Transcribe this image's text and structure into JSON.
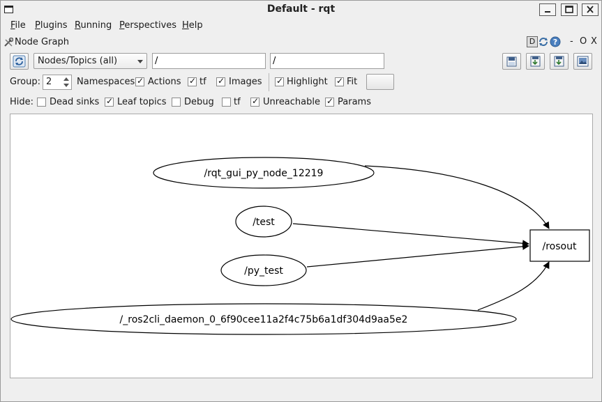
{
  "window": {
    "title": "Default - rqt",
    "minimize_glyph": "_",
    "maximize_glyph": "□",
    "close_glyph": "✕"
  },
  "menu": {
    "items": [
      {
        "label": "File",
        "mnemonic": "F",
        "rest": "ile"
      },
      {
        "label": "Plugins",
        "mnemonic": "P",
        "rest": "lugins"
      },
      {
        "label": "Running",
        "mnemonic": "R",
        "rest": "unning"
      },
      {
        "label": "Perspectives",
        "mnemonic": "P",
        "rest": "erspectives"
      },
      {
        "label": "Help",
        "mnemonic": "H",
        "rest": "elp"
      }
    ]
  },
  "plugin": {
    "title": "Node Graph",
    "d_label": "D",
    "dash_label": "-",
    "o_label": "O",
    "x_label": "X"
  },
  "toolbar": {
    "mode_selected": "Nodes/Topics (all)",
    "node_filter_value": "/",
    "topic_filter_value": "/"
  },
  "options": {
    "group_label": "Group:",
    "group_value": "2",
    "namespaces_label": "Namespaces",
    "actions_label": "Actions",
    "actions_checked": true,
    "tf_label": "tf",
    "tf_checked": true,
    "images_label": "Images",
    "images_checked": true,
    "highlight_label": "Highlight",
    "highlight_checked": true,
    "fit_label": "Fit",
    "fit_checked": true
  },
  "hide": {
    "label": "Hide:",
    "dead_sinks_label": "Dead sinks",
    "dead_sinks_checked": false,
    "leaf_topics_label": "Leaf topics",
    "leaf_topics_checked": true,
    "debug_label": "Debug",
    "debug_checked": false,
    "tf_label": "tf",
    "tf_checked": false,
    "unreachable_label": "Unreachable",
    "unreachable_checked": true,
    "params_label": "Params",
    "params_checked": true
  },
  "graph": {
    "nodes": [
      {
        "label": "/rqt_gui_py_node_12219",
        "shape": "ellipse"
      },
      {
        "label": "/test",
        "shape": "ellipse"
      },
      {
        "label": "/py_test",
        "shape": "ellipse"
      },
      {
        "label": "/_ros2cli_daemon_0_6f90cee11a2f4c75b6a1df304d9aa5e2",
        "shape": "ellipse"
      },
      {
        "label": "/rosout",
        "shape": "box"
      }
    ],
    "edges": [
      {
        "from": "/rqt_gui_py_node_12219",
        "to": "/rosout"
      },
      {
        "from": "/test",
        "to": "/rosout"
      },
      {
        "from": "/py_test",
        "to": "/rosout"
      },
      {
        "from": "/_ros2cli_daemon_0_6f90cee11a2f4c75b6a1df304d9aa5e2",
        "to": "/rosout"
      }
    ]
  }
}
